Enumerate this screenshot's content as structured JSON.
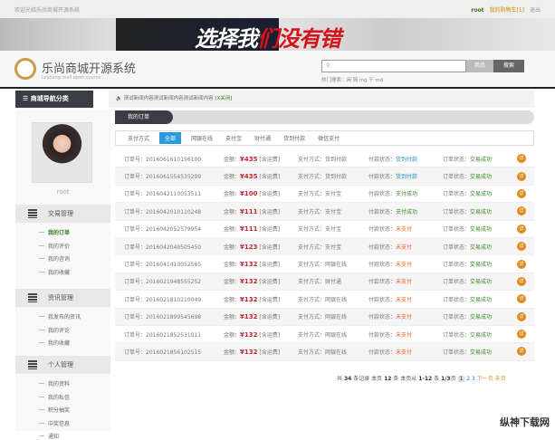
{
  "topbar": {
    "welcome": "欢迎光临乐尚商城开源系统",
    "user": "root",
    "messages": "我的购物车[1]",
    "logout": "退出"
  },
  "banner": {
    "slogan_white": "选择我",
    "slogan_red": "们没有错"
  },
  "header": {
    "brand": "乐尚商城开源系统",
    "brand_sub": "Leshang mall open source",
    "search_placeholder": "",
    "search_category": "商品",
    "search_button": "搜索",
    "hot_label": "热门搜索：",
    "hot_terms": "闲 简 ing 干 md"
  },
  "nav": {
    "category": "商城导航分类",
    "notice": "测试新闻内容测试新闻内容测试新闻内容",
    "notice_close": "[X关闭]"
  },
  "sidebar": {
    "username": "root",
    "sections": [
      {
        "title": "交易管理",
        "items": [
          "我的订单",
          "我的评价",
          "我的咨询",
          "我的收藏"
        ]
      },
      {
        "title": "资讯管理",
        "items": [
          "我发布的资讯",
          "我的评论",
          "我的收藏"
        ]
      },
      {
        "title": "个人管理",
        "items": [
          "我的资料",
          "我的私信",
          "积分抽奖",
          "中奖信息",
          "通知"
        ]
      }
    ]
  },
  "main": {
    "tab": "我的订单",
    "filter_label": "支付方式",
    "filters": [
      "全部",
      "网银在线",
      "支付宝",
      "财付通",
      "货到付款",
      "微信支付"
    ],
    "labels": {
      "order": "订单号：",
      "amount": "金额：",
      "freight": "[含运费]",
      "pay": "支付方式：",
      "pay_status": "付款状态：",
      "order_status": "订单状态：",
      "action": "详"
    },
    "orders": [
      {
        "id": "2016061610156100",
        "amount": "¥435",
        "pay": "货到付款",
        "pay_status": "货到付款",
        "status": "交易成功",
        "cls": "ok"
      },
      {
        "id": "2016061554535299",
        "amount": "¥435",
        "pay": "货到付款",
        "pay_status": "货到付款",
        "status": "交易成功",
        "cls": "ok"
      },
      {
        "id": "2016042110053511",
        "amount": "¥100",
        "pay": "支付宝",
        "pay_status": "支付成功",
        "status": "交易成功",
        "cls": "succ"
      },
      {
        "id": "2016042010110248",
        "amount": "¥111",
        "pay": "支付宝",
        "pay_status": "支付成功",
        "status": "交易成功",
        "cls": "succ"
      },
      {
        "id": "2016042052579954",
        "amount": "¥111",
        "pay": "支付宝",
        "pay_status": "未支付",
        "status": "交易成功",
        "cls": "unpaid"
      },
      {
        "id": "2016042049505450",
        "amount": "¥123",
        "pay": "支付宝",
        "pay_status": "未支付",
        "status": "交易成功",
        "cls": "unpaid"
      },
      {
        "id": "2016041410052565",
        "amount": "¥132",
        "pay": "网银在线",
        "pay_status": "未支付",
        "status": "交易成功",
        "cls": "unpaid"
      },
      {
        "id": "2016021948555252",
        "amount": "¥132",
        "pay": "财付通",
        "pay_status": "未支付",
        "status": "交易成功",
        "cls": "unpaid"
      },
      {
        "id": "2016021810210049",
        "amount": "¥132",
        "pay": "网银在线",
        "pay_status": "未支付",
        "status": "交易成功",
        "cls": "unpaid"
      },
      {
        "id": "2016021899545698",
        "amount": "¥132",
        "pay": "网银在线",
        "pay_status": "未支付",
        "status": "交易成功",
        "cls": "unpaid"
      },
      {
        "id": "2016021852531011",
        "amount": "¥132",
        "pay": "网银在线",
        "pay_status": "未支付",
        "status": "交易成功",
        "cls": "unpaid"
      },
      {
        "id": "2016021856102515",
        "amount": "¥132",
        "pay": "网银在线",
        "pay_status": "未支付",
        "status": "交易成功",
        "cls": "unpaid"
      }
    ]
  },
  "pager": {
    "t1": "共",
    "total": "34",
    "t2": "条记录  本页",
    "per": "12",
    "t3": "条  本页从",
    "range": "1-12",
    "t4": "条",
    "pages": "1/3",
    "t5": "页",
    "p1": "1",
    "p2": "2",
    "p3": "3",
    "next": "下一页",
    "last": "末页"
  },
  "watermark": "纵神下载网"
}
